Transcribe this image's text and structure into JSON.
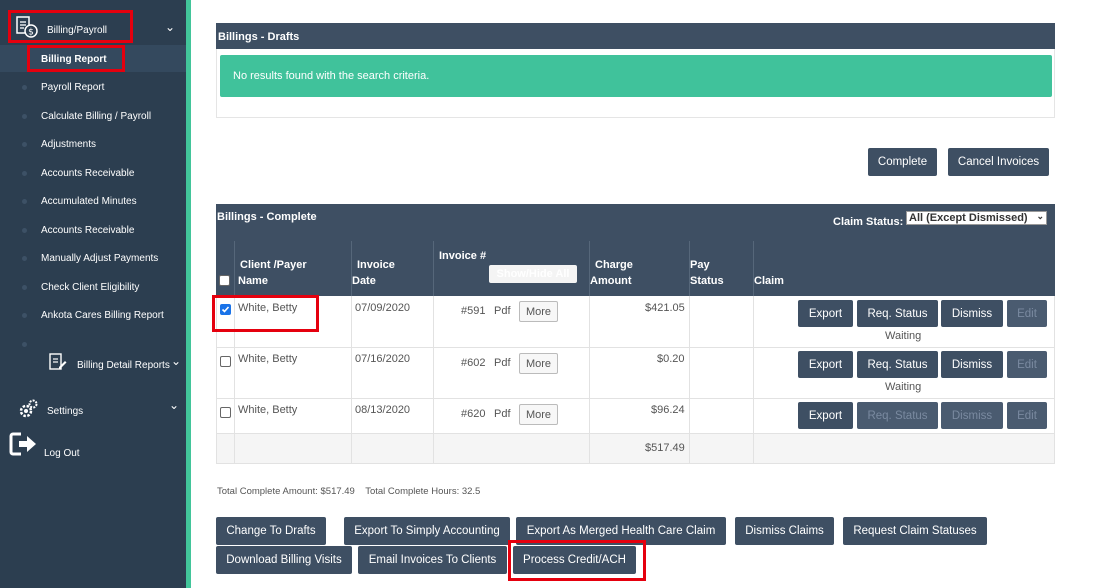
{
  "sidebar": {
    "section_label": "Billing/Payroll",
    "items": [
      {
        "label": "Billing Report"
      },
      {
        "label": "Payroll Report"
      },
      {
        "label": "Calculate Billing / Payroll"
      },
      {
        "label": "Adjustments"
      },
      {
        "label": "Accounts Receivable"
      },
      {
        "label": "Accumulated Minutes"
      },
      {
        "label": "Accounts Receivable"
      },
      {
        "label": "Manually Adjust Payments"
      },
      {
        "label": "Check Client Eligibility"
      },
      {
        "label": "Ankota Cares Billing Report"
      }
    ],
    "billing_detail_label": "Billing Detail Reports",
    "settings_label": "Settings",
    "logout_label": "Log Out"
  },
  "drafts": {
    "title": "Billings - Drafts",
    "empty_message": "No results found with the search criteria."
  },
  "actions": {
    "complete_label": "Complete",
    "cancel_label": "Cancel Invoices"
  },
  "complete": {
    "title": "Billings - Complete",
    "claim_status_label": "Claim Status:",
    "claim_status_value": "All (Except Dismissed)",
    "headers": {
      "client_l1": "Client /Payer",
      "client_l2": "Name",
      "date_l1": "Invoice",
      "date_l2": "Date",
      "invoice": "Invoice #",
      "showhide": "Show/Hide All",
      "charge_l1": "Charge",
      "charge_l2": "Amount",
      "pay_l1": "Pay",
      "pay_l2": "Status",
      "claim": "Claim"
    },
    "rows": [
      {
        "client": "White, Betty",
        "date": "07/09/2020",
        "invoice": "#591",
        "pdf": "Pdf",
        "more": "More",
        "amount": "$421.05",
        "status": "Waiting",
        "checked": true
      },
      {
        "client": "White, Betty",
        "date": "07/16/2020",
        "invoice": "#602",
        "pdf": "Pdf",
        "more": "More",
        "amount": "$0.20",
        "status": "Waiting",
        "checked": false
      },
      {
        "client": "White, Betty",
        "date": "08/13/2020",
        "invoice": "#620",
        "pdf": "Pdf",
        "more": "More",
        "amount": "$96.24",
        "status": "",
        "checked": false
      }
    ],
    "row_buttons": {
      "export": "Export",
      "req_status": "Req. Status",
      "dismiss": "Dismiss",
      "edit": "Edit"
    },
    "total": "$517.49",
    "summary": "Total Complete Amount: $517.49    Total Complete Hours: 32.5"
  },
  "bottom_buttons": {
    "change_to_drafts": "Change To Drafts",
    "export_simply": "Export To Simply Accounting",
    "export_merged": "Export As Merged Health Care Claim",
    "dismiss_claims": "Dismiss Claims",
    "request_statuses": "Request Claim Statuses",
    "download_visits": "Download Billing Visits",
    "email_invoices": "Email Invoices To Clients",
    "process_credit": "Process Credit/ACH"
  },
  "colors": {
    "sidebar": "#2c3e50",
    "accent": "#42c59a",
    "header": "#3e4f63",
    "highlight": "#e5000e"
  }
}
